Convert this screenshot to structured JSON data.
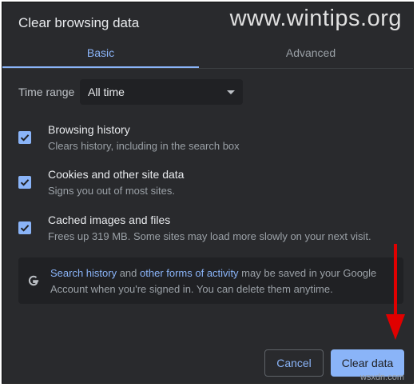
{
  "dialog": {
    "title": "Clear browsing data",
    "watermark": "www.wintips.org",
    "corner_mark": "wsxdn.com"
  },
  "tabs": [
    {
      "label": "Basic",
      "active": true
    },
    {
      "label": "Advanced",
      "active": false
    }
  ],
  "time_range": {
    "label": "Time range",
    "value": "All time"
  },
  "options": [
    {
      "title": "Browsing history",
      "desc": "Clears history, including in the search box",
      "checked": true
    },
    {
      "title": "Cookies and other site data",
      "desc": "Signs you out of most sites.",
      "checked": true
    },
    {
      "title": "Cached images and files",
      "desc": "Frees up 319 MB. Some sites may load more slowly on your next visit.",
      "checked": true
    }
  ],
  "info": {
    "link1": "Search history",
    "text1": " and ",
    "link2": "other forms of activity",
    "text2": " may be saved in your Google Account when you're signed in. You can delete them anytime."
  },
  "buttons": {
    "cancel": "Cancel",
    "clear": "Clear data"
  },
  "colors": {
    "accent": "#8ab4f8",
    "background": "#292a2d",
    "arrow": "#e00000"
  }
}
